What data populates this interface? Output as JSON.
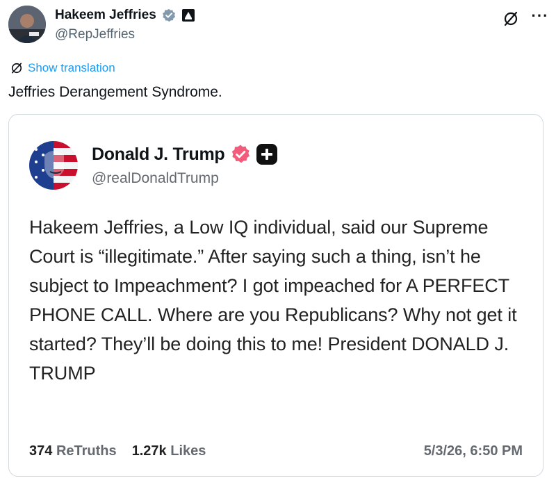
{
  "post": {
    "author_name": "Hakeem Jeffries",
    "author_handle": "@RepJeffries",
    "show_translation": "Show translation",
    "text": "Jeffries Derangement Syndrome.",
    "icons": [
      "grok-icon",
      "more-icon",
      "verified-icon",
      "government-badge-icon",
      "translate-icon"
    ]
  },
  "quote": {
    "author_name": "Donald J. Trump",
    "author_handle": "@realDonaldTrump",
    "text": "Hakeem Jeffries, a Low IQ individual, said our Supreme Court is “illegitimate.” After saying such a thing, isn’t he subject to Impeachment? I got impeached for A PERFECT PHONE CALL. Where are you Republicans? Why not get it started? They’ll be doing this to me! President DONALD J. TRUMP",
    "retruths_count": "374",
    "retruths_label": "ReTruths",
    "likes_count": "1.27k",
    "likes_label": "Likes",
    "timestamp": "5/3/26, 6:50 PM"
  },
  "colors": {
    "link": "#1d9bf0",
    "verified_blue": "#1d9bf0",
    "truth_badge": "#f25c7a",
    "muted_text": "#536471"
  }
}
